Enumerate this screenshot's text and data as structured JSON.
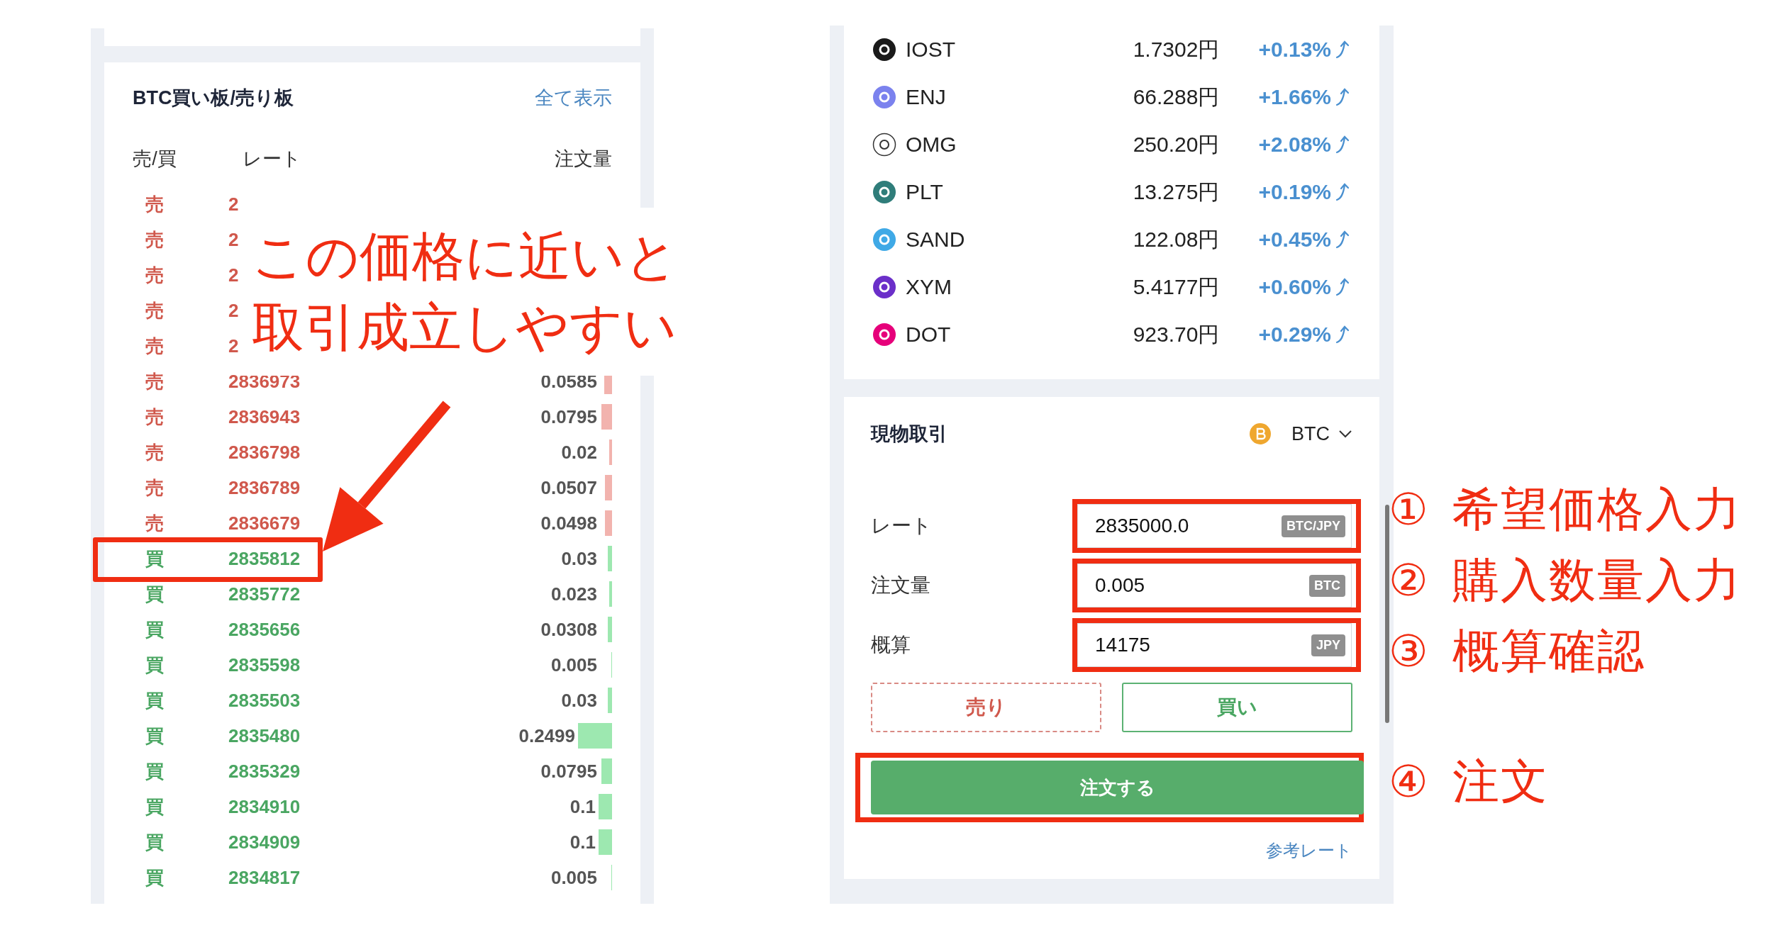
{
  "order_book": {
    "title": "BTC買い板/売り板",
    "view_all": "全て表示",
    "columns": [
      "売/買",
      "レート",
      "注文量"
    ],
    "rows": [
      {
        "side": "売",
        "kind": "sell",
        "rate": "2",
        "highlighted": false
      },
      {
        "side": "売",
        "kind": "sell",
        "rate": "2",
        "highlighted": false
      },
      {
        "side": "売",
        "kind": "sell",
        "rate": "2",
        "highlighted": false
      },
      {
        "side": "売",
        "kind": "sell",
        "rate": "2",
        "highlighted": false
      },
      {
        "side": "売",
        "kind": "sell",
        "rate": "2",
        "highlighted": false
      },
      {
        "side": "売",
        "kind": "sell",
        "rate": "2836973",
        "quantity": "0.0585",
        "highlighted": false
      },
      {
        "side": "売",
        "kind": "sell",
        "rate": "2836943",
        "quantity": "0.0795",
        "highlighted": false
      },
      {
        "side": "売",
        "kind": "sell",
        "rate": "2836798",
        "quantity": "0.02",
        "highlighted": false
      },
      {
        "side": "売",
        "kind": "sell",
        "rate": "2836789",
        "quantity": "0.0507",
        "highlighted": false
      },
      {
        "side": "売",
        "kind": "sell",
        "rate": "2836679",
        "quantity": "0.0498",
        "highlighted": false
      },
      {
        "side": "買",
        "kind": "buy",
        "rate": "2835812",
        "quantity": "0.03",
        "highlighted": true
      },
      {
        "side": "買",
        "kind": "buy",
        "rate": "2835772",
        "quantity": "0.023",
        "highlighted": false
      },
      {
        "side": "買",
        "kind": "buy",
        "rate": "2835656",
        "quantity": "0.0308",
        "highlighted": false
      },
      {
        "side": "買",
        "kind": "buy",
        "rate": "2835598",
        "quantity": "0.005",
        "highlighted": false
      },
      {
        "side": "買",
        "kind": "buy",
        "rate": "2835503",
        "quantity": "0.03",
        "highlighted": false
      },
      {
        "side": "買",
        "kind": "buy",
        "rate": "2835480",
        "quantity": "0.2499",
        "highlighted": false
      },
      {
        "side": "買",
        "kind": "buy",
        "rate": "2835329",
        "quantity": "0.0795",
        "highlighted": false
      },
      {
        "side": "買",
        "kind": "buy",
        "rate": "2834910",
        "quantity": "0.1",
        "highlighted": false
      },
      {
        "side": "買",
        "kind": "buy",
        "rate": "2834909",
        "quantity": "0.1",
        "highlighted": false
      },
      {
        "side": "買",
        "kind": "buy",
        "rate": "2834817",
        "quantity": "0.005",
        "highlighted": false
      }
    ]
  },
  "market_list": {
    "rows": [
      {
        "symbol": "IOST",
        "price": "1.7302円",
        "change": "+0.13%",
        "color": "#1a1a1a"
      },
      {
        "symbol": "ENJ",
        "price": "66.288円",
        "change": "+1.66%",
        "color": "#7b82ee"
      },
      {
        "symbol": "OMG",
        "price": "250.20円",
        "change": "+2.08%"
      },
      {
        "symbol": "PLT",
        "price": "13.275円",
        "change": "+0.19%",
        "color": "#2f7d7a"
      },
      {
        "symbol": "SAND",
        "price": "122.08円",
        "change": "+0.45%",
        "color": "#3fa9e6"
      },
      {
        "symbol": "XYM",
        "price": "5.4177円",
        "change": "+0.60%",
        "color": "#6b2fc9"
      },
      {
        "symbol": "DOT",
        "price": "923.70円",
        "change": "+0.29%",
        "color": "#e6007a"
      }
    ]
  },
  "spot_trade": {
    "title": "現物取引",
    "currency": "BTC",
    "fields": [
      {
        "label": "レート",
        "value": "2835000.0",
        "unit": "BTC/JPY",
        "highlighted": true
      },
      {
        "label": "注文量",
        "value": "0.005",
        "unit": "BTC",
        "highlighted": true
      },
      {
        "label": "概算",
        "value": "14175",
        "unit": "JPY",
        "highlighted": true
      }
    ],
    "side_buttons": [
      {
        "label": "売り",
        "kind": "sell"
      },
      {
        "label": "買い",
        "kind": "buy"
      }
    ],
    "order_button": {
      "label": "注文する",
      "highlighted": true
    },
    "reference_link": "参考レート"
  },
  "annotations": {
    "note": {
      "lines": [
        "この価格に近いと",
        "取引成立しやすい"
      ]
    },
    "steps": [
      {
        "number": "①",
        "text": "希望価格入力"
      },
      {
        "number": "②",
        "text": "購入数量入力"
      },
      {
        "number": "③",
        "text": "概算確認"
      },
      {
        "number": "④",
        "text": "注文"
      }
    ]
  }
}
